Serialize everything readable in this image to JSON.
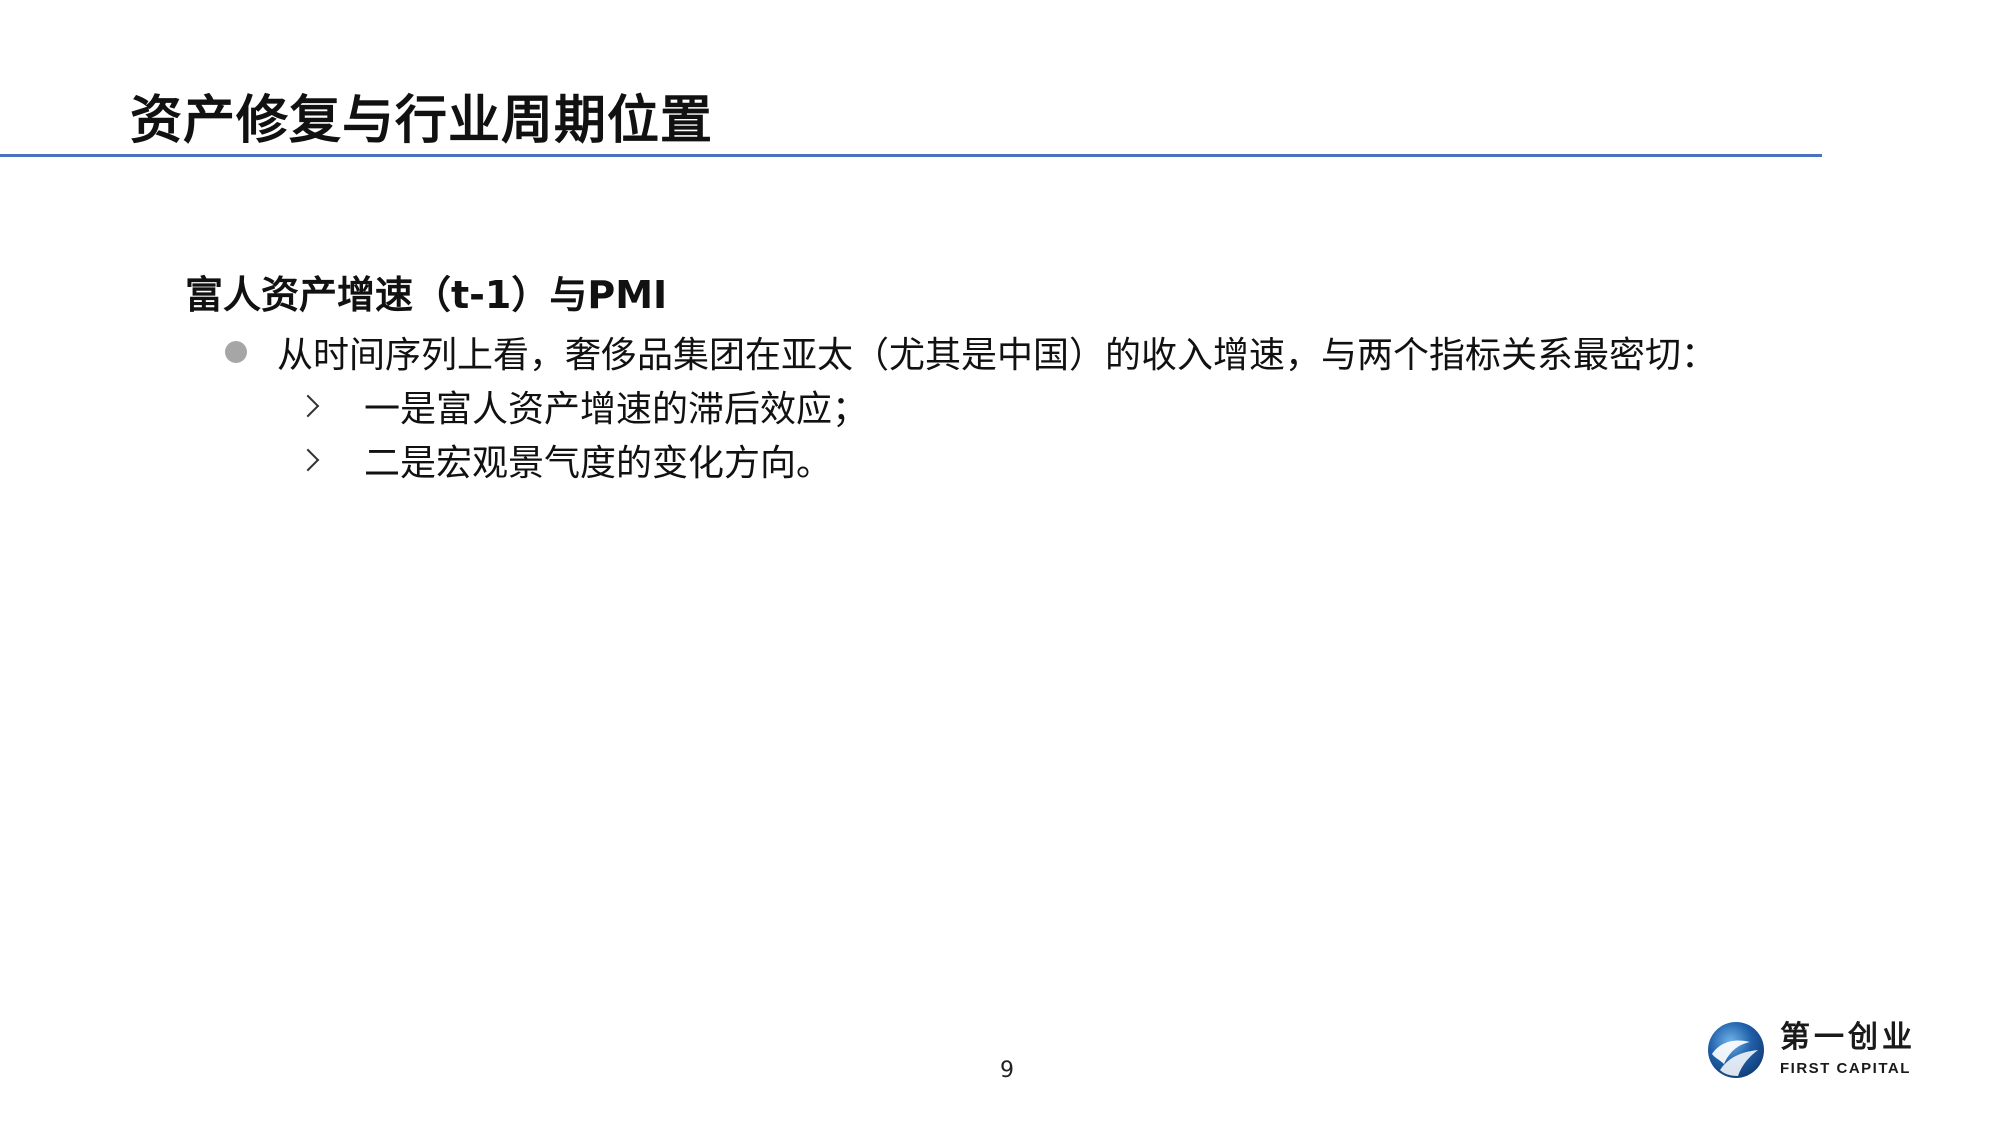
{
  "slide": {
    "title": "资产修复与行业周期位置",
    "section_heading": "富人资产增速（t-1）与PMI",
    "bullet": "从时间序列上看，奢侈品集团在亚太（尤其是中国）的收入增速，与两个指标关系最密切：",
    "sub_bullets": [
      "一是富人资产增速的滞后效应；",
      "二是宏观景气度的变化方向。"
    ],
    "page_number": "9"
  },
  "logo": {
    "cn": "第一创业",
    "en": "FIRST CAPITAL"
  },
  "colors": {
    "title_rule": "#4a72c4",
    "bullet_dot": "#a6a6a6",
    "logo_blue": "#1f5fa8"
  }
}
